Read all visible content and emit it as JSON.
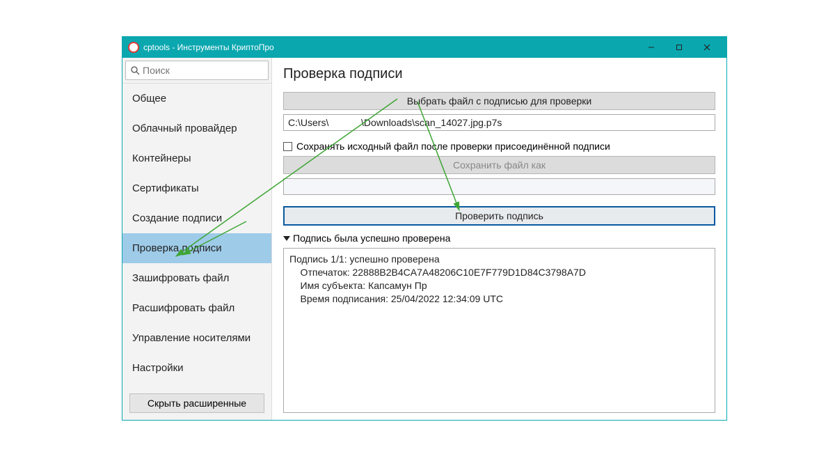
{
  "window": {
    "title": "cptools - Инструменты КриптоПро"
  },
  "search": {
    "placeholder": "Поиск"
  },
  "sidebar": {
    "items": [
      {
        "label": "Общее",
        "active": false
      },
      {
        "label": "Облачный провайдер",
        "active": false
      },
      {
        "label": "Контейнеры",
        "active": false
      },
      {
        "label": "Сертификаты",
        "active": false
      },
      {
        "label": "Создание подписи",
        "active": false
      },
      {
        "label": "Проверка подписи",
        "active": true
      },
      {
        "label": "Зашифровать файл",
        "active": false
      },
      {
        "label": "Расшифровать файл",
        "active": false
      },
      {
        "label": "Управление носителями",
        "active": false
      },
      {
        "label": "Настройки",
        "active": false
      }
    ],
    "hide_extended": "Скрыть расширенные"
  },
  "main": {
    "title": "Проверка подписи",
    "choose_file_btn": "Выбрать файл с подписью для проверки",
    "file_path": "C:\\Users\\            \\Downloads\\scan_14027.jpg.p7s",
    "save_original_checkbox": "Сохранять исходный файл после проверки присоединённой подписи",
    "save_as_btn": "Сохранить файл как",
    "verify_btn": "Проверить подпись",
    "status_summary": "Подпись была успешно проверена",
    "result_text": "Подпись 1/1: успешно проверена\n    Отпечаток: 22888B2B4CA7A48206C10E7F779D1D84C3798A7D\n    Имя субъекта: Капсамун Пр\n    Время подписания: 25/04/2022 12:34:09 UTC"
  }
}
